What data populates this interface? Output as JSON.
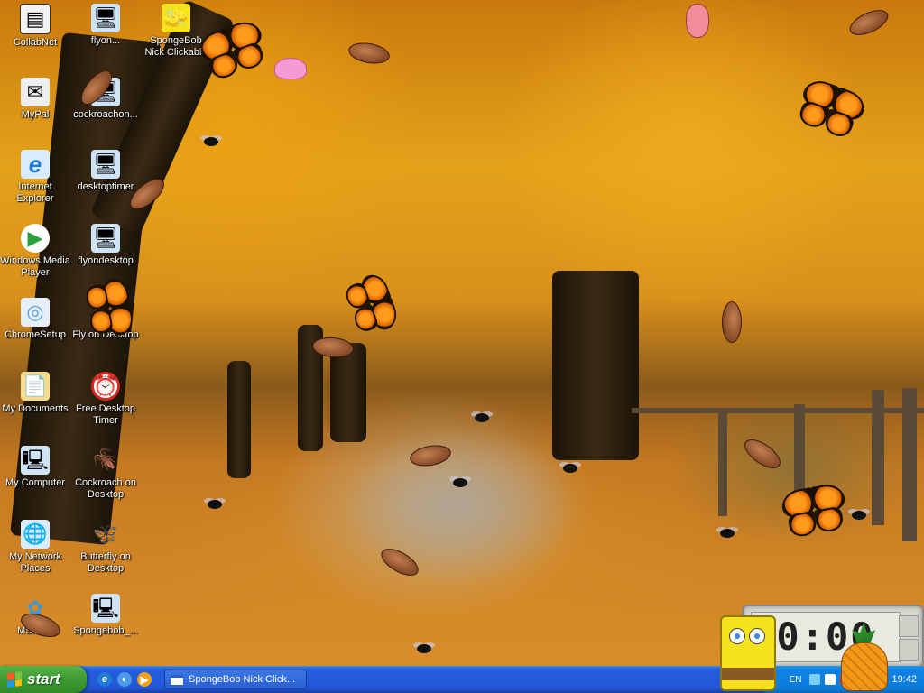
{
  "desktop": {
    "icons": [
      {
        "id": "collabnet",
        "label": "CollabNet",
        "glyph": "▤",
        "color": "#3a3a3a"
      },
      {
        "id": "flyondesktop-shortcut",
        "label": "flyon...",
        "glyph": "🖥",
        "color": "#ffffff"
      },
      {
        "id": "spongebob-nick-clickable",
        "label": "SpongeBob Nick Clickable",
        "glyph": "🧽",
        "color": "#f6e21c"
      },
      {
        "id": "mypal",
        "label": "MyPal",
        "glyph": "✉",
        "color": "#ffffff"
      },
      {
        "id": "cockroachon",
        "label": "cockroachon...",
        "glyph": "🖥",
        "color": "#ffffff"
      },
      {
        "id": "internet-explorer",
        "label": "Internet Explorer",
        "glyph": "e",
        "color": "#1e7bd8"
      },
      {
        "id": "desktoptimer",
        "label": "desktoptimer",
        "glyph": "🖥",
        "color": "#ffffff"
      },
      {
        "id": "windows-media-player",
        "label": "Windows Media Player",
        "glyph": "▶",
        "color": "#2aa03c"
      },
      {
        "id": "flyondesktop",
        "label": "flyondesktop",
        "glyph": "🖥",
        "color": "#ffffff"
      },
      {
        "id": "chromesetup",
        "label": "ChromeSetup",
        "glyph": "◎",
        "color": "#5aa0e0"
      },
      {
        "id": "fly-on-desktop",
        "label": "Fly on Desktop",
        "glyph": "🦋",
        "color": "#ff8a1a"
      },
      {
        "id": "my-documents",
        "label": "My Documents",
        "glyph": "📄",
        "color": "#f1d37a"
      },
      {
        "id": "free-desktop-timer",
        "label": "Free Desktop Timer",
        "glyph": "⏰",
        "color": "#d8271e"
      },
      {
        "id": "my-computer",
        "label": "My Computer",
        "glyph": "🖳",
        "color": "#5aa0e0"
      },
      {
        "id": "cockroach-on-desktop",
        "label": "Cockroach on Desktop",
        "glyph": "🪳",
        "color": "#8a4a1c"
      },
      {
        "id": "my-network-places",
        "label": "My Network Places",
        "glyph": "🌐",
        "color": "#3a8ad6"
      },
      {
        "id": "butterfly-on-desktop",
        "label": "Butterfly on Desktop",
        "glyph": "🦋",
        "color": "#ff8a1a"
      },
      {
        "id": "msn",
        "label": "MSN I...",
        "glyph": "✿",
        "color": "#3a9ad6"
      },
      {
        "id": "spongebob-installer",
        "label": "Spongebob_...",
        "glyph": "🖳",
        "color": "#ffffff"
      }
    ]
  },
  "timer_widget": {
    "display": "0:00"
  },
  "taskbar": {
    "start_label": "start",
    "quick_launch": [
      {
        "id": "ie",
        "glyph": "e",
        "color": "#1e7bd8"
      },
      {
        "id": "show-desktop",
        "glyph": "◐",
        "color": "#1e7bd8"
      },
      {
        "id": "media-player",
        "glyph": "▶",
        "color": "#f1a21a"
      }
    ],
    "active_task": "SpongeBob Nick Click...",
    "tray": {
      "language": "EN",
      "time": "19:42",
      "icons": [
        {
          "id": "network",
          "color": "#7ad0ff"
        },
        {
          "id": "volume",
          "color": "#ffffff"
        },
        {
          "id": "security",
          "color": "#e23a2a"
        },
        {
          "id": "timer",
          "color": "#e2a21a"
        },
        {
          "id": "messenger",
          "color": "#4ac04a"
        }
      ]
    }
  }
}
